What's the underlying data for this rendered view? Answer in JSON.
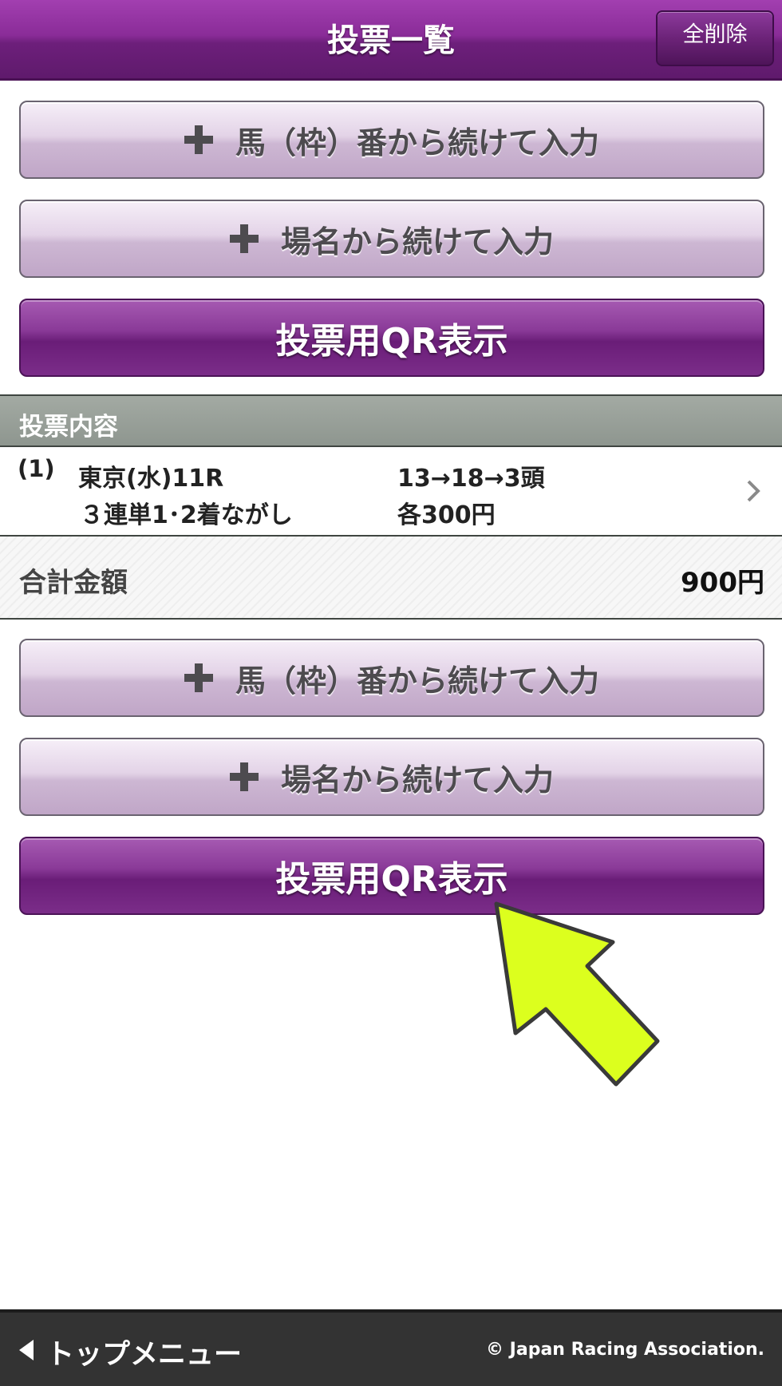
{
  "header": {
    "title": "投票一覧",
    "delete_all_label": "全削除"
  },
  "buttons": {
    "continue_by_number": "馬（枠）番から続けて入力",
    "continue_by_venue": "場名から続けて入力",
    "show_qr": "投票用QR表示"
  },
  "section": {
    "title": "投票内容"
  },
  "bets": [
    {
      "index": "(1)",
      "race": "東京(水)11R",
      "bet_type": "３連単1･2着ながし",
      "horses": "13→18→3頭",
      "amount": "各300円"
    }
  ],
  "total": {
    "label": "合計金額",
    "value": "900円"
  },
  "footer": {
    "top_menu_label": "トップメニュー",
    "copyright": "© Japan Racing Association."
  },
  "colors": {
    "accent_purple": "#7b2d89",
    "pointer_arrow": "#dcff1e"
  }
}
